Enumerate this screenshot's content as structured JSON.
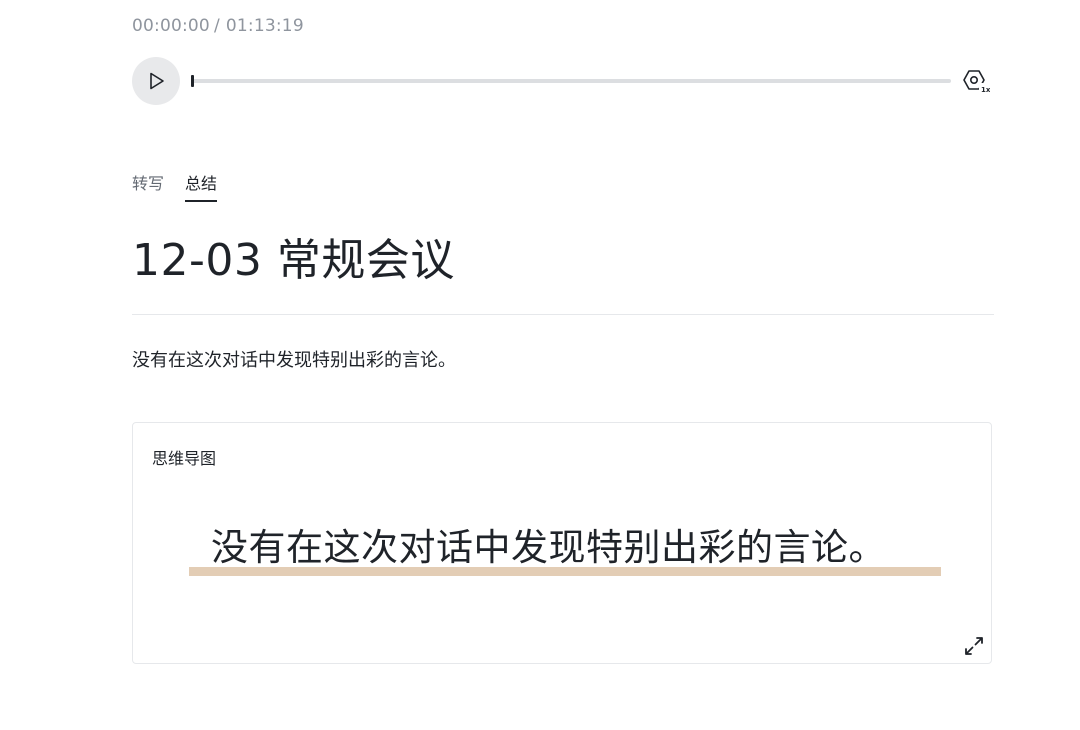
{
  "player": {
    "current_time": "00:00:00",
    "separator": "/",
    "duration": "01:13:19",
    "progress": 0,
    "speed_label": "1x",
    "icons": {
      "play": "play-icon",
      "speed": "playback-speed-icon"
    }
  },
  "tabs": [
    {
      "label": "转写",
      "active": false
    },
    {
      "label": "总结",
      "active": true
    }
  ],
  "meeting": {
    "title": "12-03 常规会议"
  },
  "summary": {
    "text": "没有在这次对话中发现特别出彩的言论。"
  },
  "mindmap": {
    "title": "思维导图",
    "root_node": "没有在这次对话中发现特别出彩的言论。",
    "node_accent_color": "#e3cdb5",
    "icons": {
      "expand": "expand-icon"
    }
  }
}
